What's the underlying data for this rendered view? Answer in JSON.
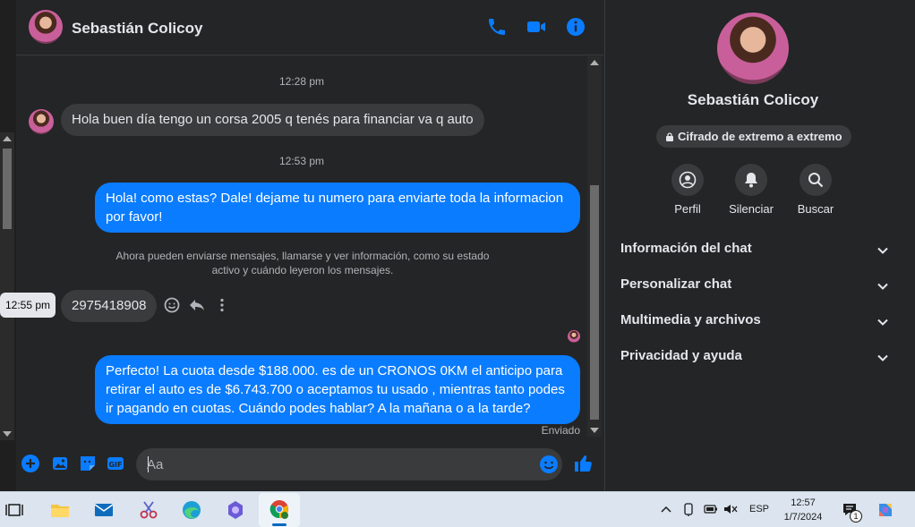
{
  "contact": {
    "name": "Sebastián Colicoy"
  },
  "messages": {
    "time1": "12:28 pm",
    "incoming1": "Hola buen día tengo un corsa 2005 q tenés para financiar va q auto",
    "time2": "12:53 pm",
    "outgoing1_line1": "Hola! como estas? Dale! dejame tu numero para enviarte toda la informacion",
    "outgoing1_line2": "por favor!",
    "system_line1": "Ahora pueden enviarse mensajes, llamarse y ver información, como su estado",
    "system_line2": "activo y cuándo leyeron los mensajes.",
    "tooltip_time": "12:55 pm",
    "incoming2": "2975418908",
    "outgoing2_line1": "Perfecto! La cuota desde $188.000. es de un CRONOS 0KM el anticipo para",
    "outgoing2_line2": "retirar el auto es de $6.743.700 o aceptamos tu usado , mientras tanto podes",
    "outgoing2_line3": "ir pagando en cuotas. Cuándo podes hablar? A la mañana o a la tarde?",
    "status": "Enviado"
  },
  "composer": {
    "placeholder": "Aa"
  },
  "sidebar": {
    "name": "Sebastián Colicoy",
    "encryption": "Cifrado de extremo a extremo",
    "actions": [
      "Perfil",
      "Silenciar",
      "Buscar"
    ],
    "sections": [
      "Información del chat",
      "Personalizar chat",
      "Multimedia y archivos",
      "Privacidad y ayuda"
    ]
  },
  "taskbar": {
    "language": "ESP",
    "time": "12:57",
    "date": "1/7/2024",
    "notification_count": "1"
  },
  "colors": {
    "accent": "#0a7cff",
    "bubble_in": "#3a3b3c",
    "background": "#242526"
  }
}
